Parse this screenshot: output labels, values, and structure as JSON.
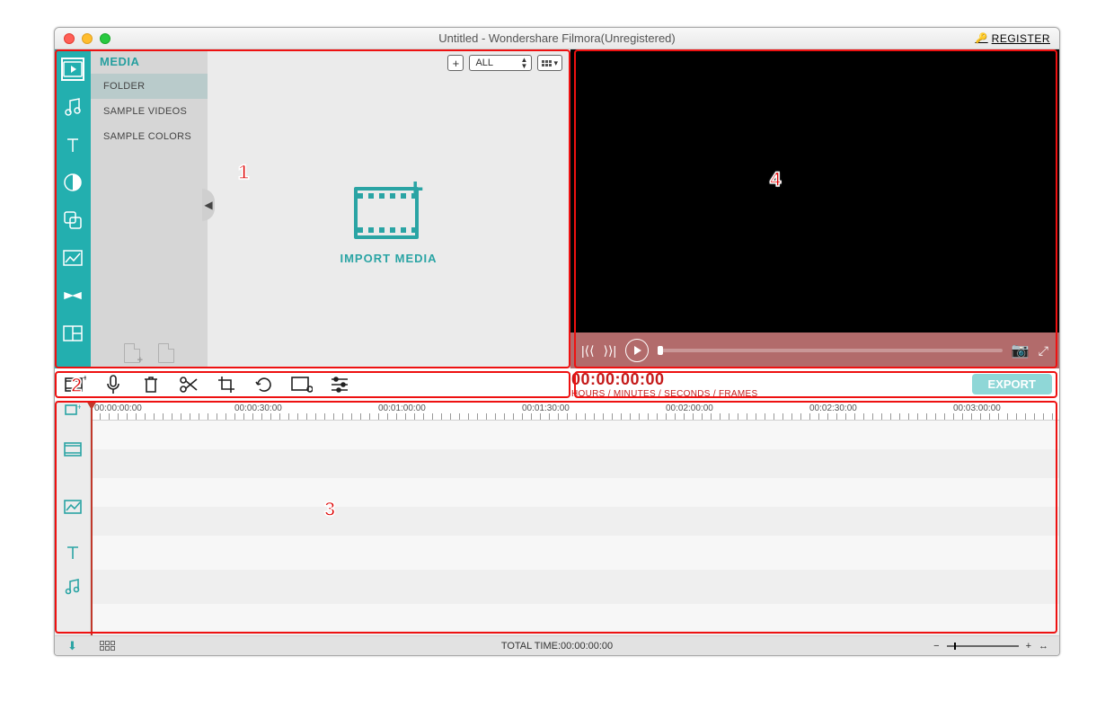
{
  "window": {
    "title": "Untitled - Wondershare Filmora(Unregistered)",
    "register": "REGISTER"
  },
  "media": {
    "header": "MEDIA",
    "folders": [
      "FOLDER",
      "SAMPLE VIDEOS",
      "SAMPLE COLORS"
    ],
    "add_tooltip": "+",
    "filter": "ALL",
    "import_label": "IMPORT MEDIA"
  },
  "preview": {
    "timecode": "00:00:00:00",
    "timecode_sub": "HOURS / MINUTES / SECONDS / FRAMES"
  },
  "export_label": "EXPORT",
  "ruler": {
    "labels": [
      "00:00:00:00",
      "00:00:30:00",
      "00:01:00:00",
      "00:01:30:00",
      "00:02:00:00",
      "00:02:30:00",
      "00:03:00:00"
    ]
  },
  "footer": {
    "total_label": "TOTAL TIME:",
    "total_time": "00:00:00:00"
  },
  "annot": {
    "l1": "1",
    "l2": "2",
    "l3": "3",
    "l4": "4"
  }
}
